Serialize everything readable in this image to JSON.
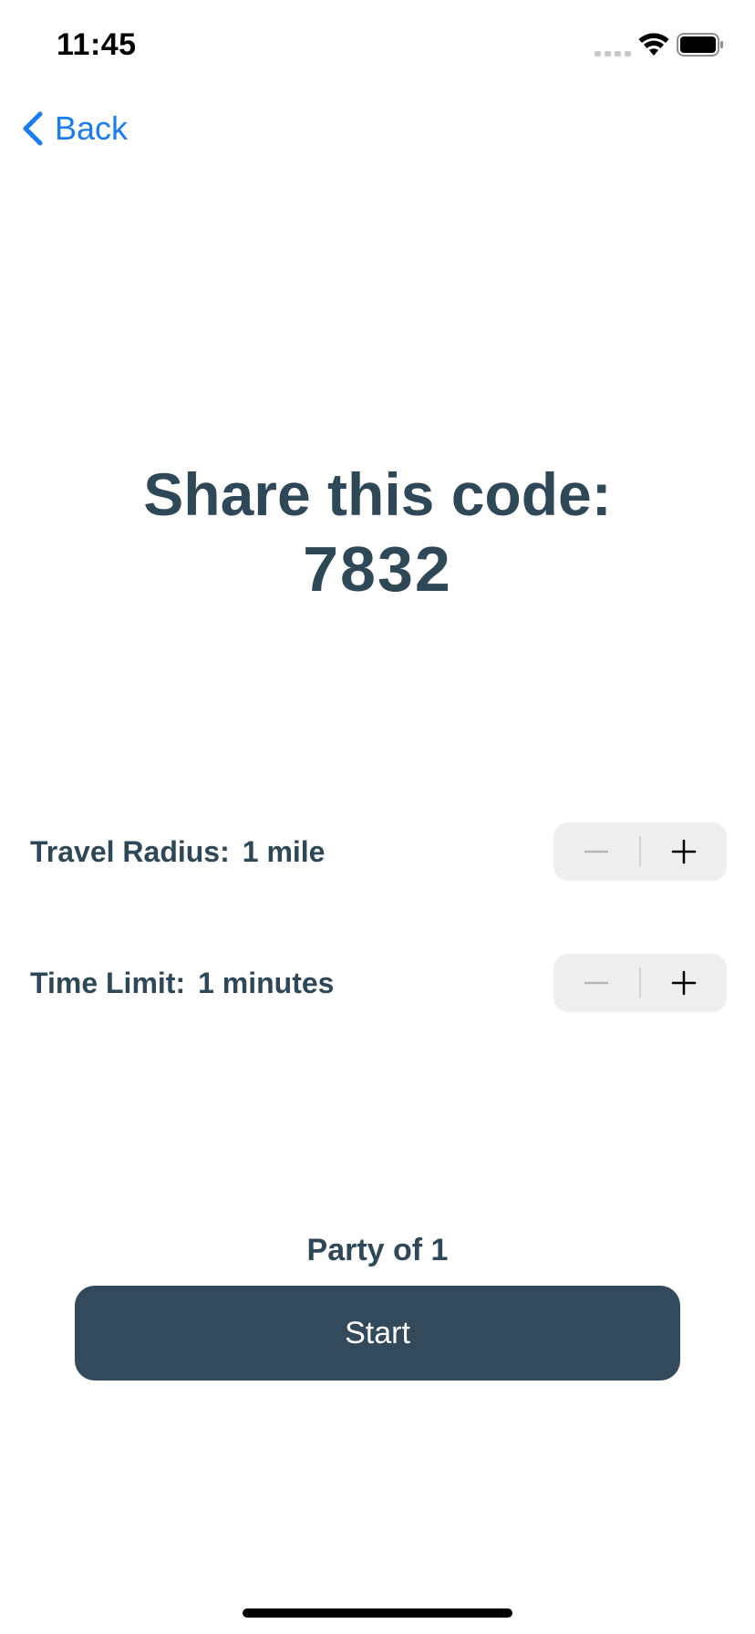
{
  "status_bar": {
    "time": "11:45",
    "icons": [
      "signal-icon",
      "wifi-icon",
      "battery-icon"
    ]
  },
  "nav": {
    "back_label": "Back",
    "back_icon": "chevron-left-icon",
    "accent_color": "#1a7cf5"
  },
  "share": {
    "title": "Share this code:",
    "code": "7832"
  },
  "settings": {
    "radius": {
      "label": "Travel Radius:",
      "value": "1 mile",
      "decrement_icon": "minus-icon",
      "increment_icon": "plus-icon"
    },
    "time_limit": {
      "label": "Time Limit:",
      "value": "1 minutes",
      "decrement_icon": "minus-icon",
      "increment_icon": "plus-icon"
    }
  },
  "party": {
    "label": "Party of 1"
  },
  "start": {
    "label": "Start"
  },
  "colors": {
    "primary_text": "#2f4858",
    "button_bg": "#324a5b",
    "stepper_bg": "#eeeeef"
  }
}
